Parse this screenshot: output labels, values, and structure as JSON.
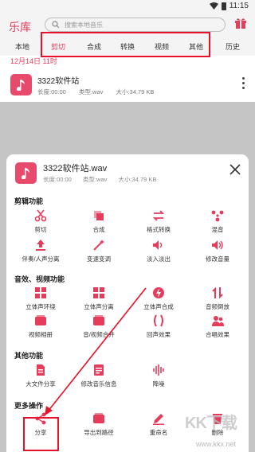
{
  "status": {
    "time": "11:15"
  },
  "header": {
    "title": "乐库",
    "search_placeholder": "搜索本地音乐"
  },
  "tabs": [
    {
      "label": "本地"
    },
    {
      "label": "剪切"
    },
    {
      "label": "合成"
    },
    {
      "label": "转换"
    },
    {
      "label": "视频"
    },
    {
      "label": "其他"
    },
    {
      "label": "历史"
    }
  ],
  "list": {
    "date": "12月14日 11时",
    "file": {
      "name": "3322软件站",
      "duration": "长度:00:00",
      "type": "类型:wav",
      "size": "大小:34.79 KB"
    }
  },
  "sheet": {
    "file_name": "3322软件站.wav",
    "duration": "长度:00:00",
    "type": "类型:wav",
    "size": "大小:34.79 KB",
    "sections": [
      {
        "title": "剪辑功能"
      },
      {
        "title": "音效、视频功能"
      },
      {
        "title": "其他功能"
      },
      {
        "title": "更多操作"
      }
    ],
    "edit_items": [
      {
        "label": "剪切",
        "icon": "scissors-icon"
      },
      {
        "label": "合成",
        "icon": "merge-icon"
      },
      {
        "label": "格式转换",
        "icon": "convert-icon"
      },
      {
        "label": "混音",
        "icon": "mix-icon"
      },
      {
        "label": "伴奏/人声分离",
        "icon": "upload-icon"
      },
      {
        "label": "变速变调",
        "icon": "magic-icon"
      },
      {
        "label": "淡入淡出",
        "icon": "volume-fade-icon"
      },
      {
        "label": "修改音量",
        "icon": "volume-icon"
      }
    ],
    "effect_items": [
      {
        "label": "立体声环绕",
        "icon": "surround-icon"
      },
      {
        "label": "立体声分离",
        "icon": "stereo-split-icon"
      },
      {
        "label": "立体声合成",
        "icon": "stereo-merge-icon"
      },
      {
        "label": "音频倒放",
        "icon": "reverse-icon"
      },
      {
        "label": "视频相册",
        "icon": "album-icon"
      },
      {
        "label": "音/视频合并",
        "icon": "av-merge-icon"
      },
      {
        "label": "回声效果",
        "icon": "echo-icon"
      },
      {
        "label": "合唱效果",
        "icon": "chorus-icon"
      }
    ],
    "other_items": [
      {
        "label": "大文件分享",
        "icon": "file-share-icon"
      },
      {
        "label": "修改音乐信息",
        "icon": "info-edit-icon"
      },
      {
        "label": "降噪",
        "icon": "denoise-icon"
      }
    ],
    "more_items": [
      {
        "label": "分享",
        "icon": "share-icon"
      },
      {
        "label": "导出到路径",
        "icon": "export-icon"
      },
      {
        "label": "重命名",
        "icon": "rename-icon"
      },
      {
        "label": "删除",
        "icon": "delete-icon"
      }
    ]
  },
  "watermark": {
    "text": "KK下载",
    "url": "www.kkx.net"
  },
  "colors": {
    "accent": "#e53c5c",
    "highlight_box": "#e8102a"
  }
}
